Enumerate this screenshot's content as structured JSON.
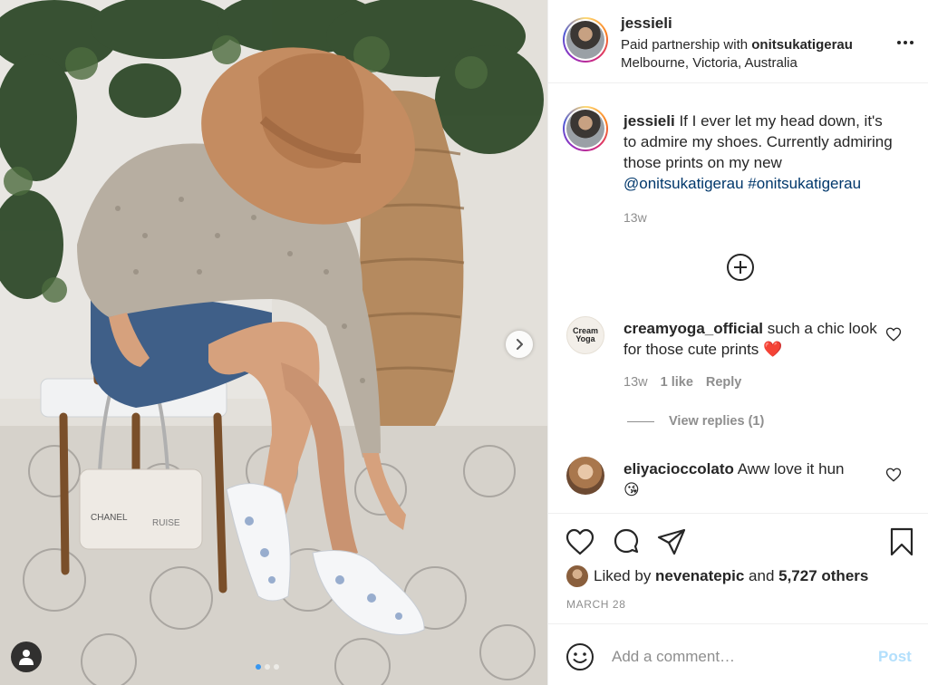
{
  "post": {
    "username": "jessieli",
    "partnership_prefix": "Paid partnership with ",
    "partner": "onitsukatigerau",
    "location": "Melbourne, Victoria, Australia"
  },
  "caption": {
    "username": "jessieli",
    "text": "If I ever let my head down, it's to admire my shoes. Currently admiring those prints on my new",
    "mention": "@onitsukatigerau",
    "hashtag": "#onitsukatigerau",
    "time": "13w"
  },
  "comments": [
    {
      "username": "creamyoga_official",
      "text": "such a chic look for those cute prints",
      "emoji": "❤️",
      "avatar_text": "Cream Yoga",
      "time": "13w",
      "likes": "1 like",
      "reply": "Reply",
      "view_replies": "View replies (1)"
    },
    {
      "username": "eliyacioccolato",
      "text": "Aww love it hun",
      "emoji": "😘"
    }
  ],
  "likes": {
    "prefix": "Liked by ",
    "user": "nevenatepic",
    "middle": " and ",
    "others": "5,727 others"
  },
  "date": "MARCH 28",
  "add_comment": {
    "placeholder": "Add a comment…",
    "post_label": "Post"
  },
  "photo": {
    "bag_text_1": "CHANEL",
    "bag_text_2": "RUISE"
  },
  "colors": {
    "text": "#262626",
    "muted": "#8e8e8e",
    "link": "#00376b",
    "post_disabled": "#b2dffc",
    "heart_emoji": "#ed4956"
  },
  "icons": {
    "more": "more-options-icon",
    "load_more": "plus-circle-icon",
    "like": "heart-icon",
    "comment": "comment-bubble-icon",
    "share": "paper-plane-icon",
    "save": "bookmark-icon",
    "emoji": "smiley-icon",
    "next": "chevron-right-icon",
    "tags": "user-tag-icon"
  }
}
